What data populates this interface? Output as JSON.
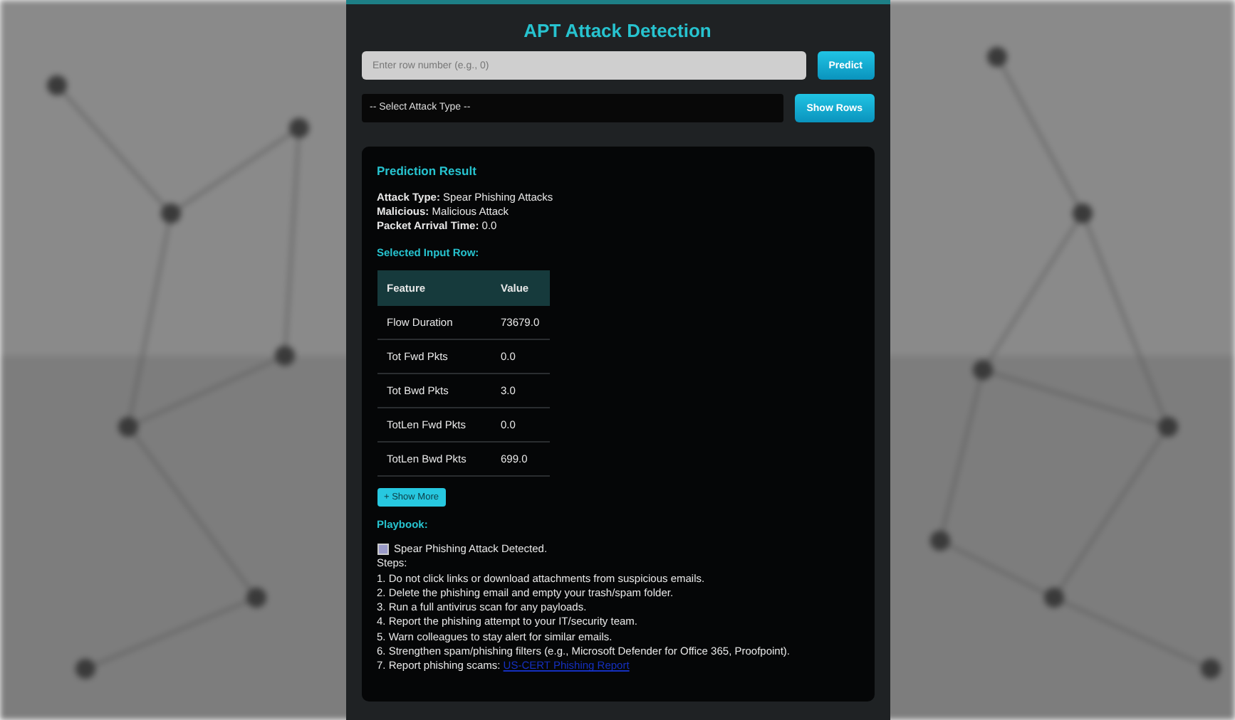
{
  "title": "APT Attack Detection",
  "row_input": {
    "placeholder": "Enter row number (e.g., 0)"
  },
  "predict_button": "Predict",
  "attack_select": {
    "value": "-- Select Attack Type --"
  },
  "show_rows_button": "Show Rows",
  "result": {
    "heading": "Prediction Result",
    "fields": [
      {
        "label": "Attack Type:",
        "value": "Spear Phishing Attacks"
      },
      {
        "label": "Malicious:",
        "value": "Malicious Attack"
      },
      {
        "label": "Packet Arrival Time:",
        "value": "0.0"
      }
    ],
    "input_row_heading": "Selected Input Row:",
    "table": {
      "columns": [
        "Feature",
        "Value"
      ],
      "rows": [
        [
          "Flow Duration",
          "73679.0"
        ],
        [
          "Tot Fwd Pkts",
          "0.0"
        ],
        [
          "Tot Bwd Pkts",
          "3.0"
        ],
        [
          "TotLen Fwd Pkts",
          "0.0"
        ],
        [
          "TotLen Bwd Pkts",
          "699.0"
        ]
      ]
    },
    "show_more_button": "+ Show More",
    "playbook": {
      "heading": "Playbook:",
      "alert": "Spear Phishing Attack Detected.",
      "steps_label": "Steps:",
      "steps": [
        "1. Do not click links or download attachments from suspicious emails.",
        "2. Delete the phishing email and empty your trash/spam folder.",
        "3. Run a full antivirus scan for any payloads.",
        "4. Report the phishing attempt to your IT/security team.",
        "5. Warn colleagues to stay alert for similar emails.",
        "6. Strengthen spam/phishing filters (e.g., Microsoft Defender for Office 365, Proofpoint)."
      ],
      "last_step": {
        "text": "7. Report phishing scams:",
        "link": "US-CERT Phishing Report"
      }
    }
  }
}
